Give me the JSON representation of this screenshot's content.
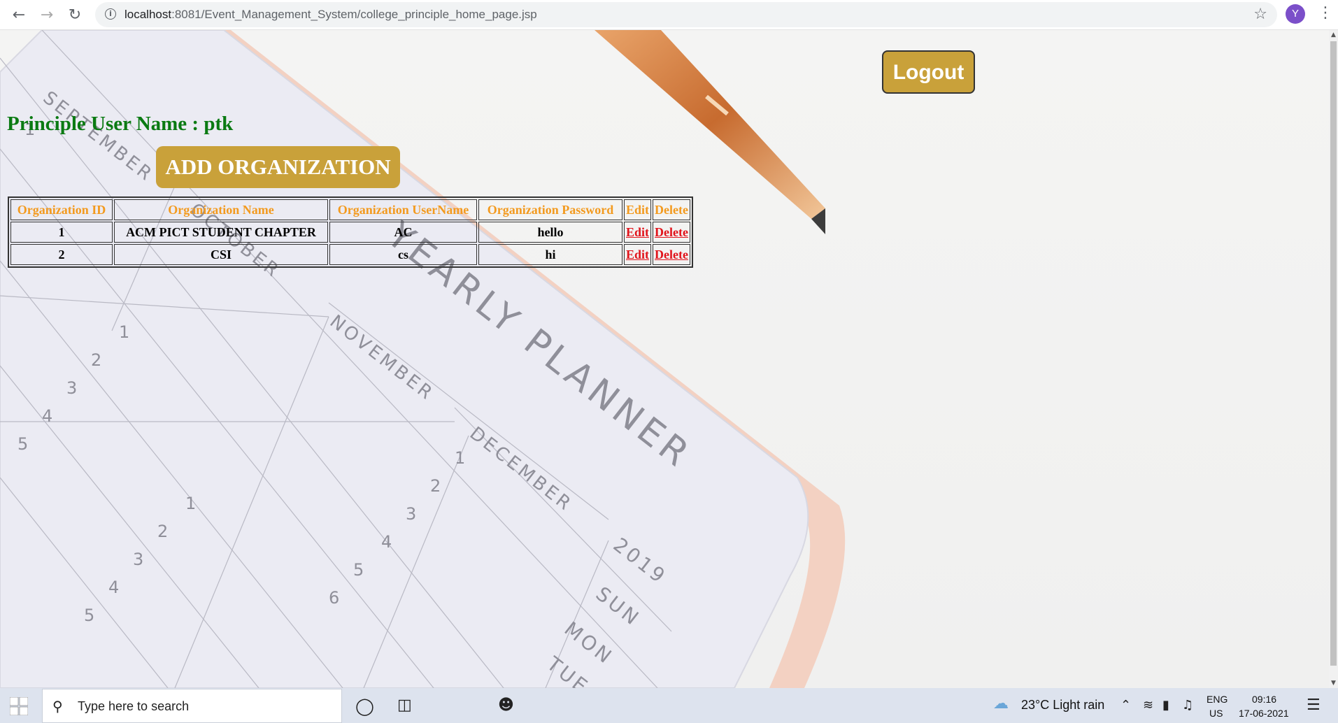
{
  "browser": {
    "url_host": "localhost",
    "url_path": ":8081/Event_Management_System/college_principle_home_page.jsp",
    "profile_initial": "Y"
  },
  "page": {
    "logout_label": "Logout",
    "principle_label": "Principle User Name : ptk",
    "add_org_label": "ADD ORGANIZATION",
    "table": {
      "headers": [
        "Organization ID",
        "Organization Name",
        "Organization UserName",
        "Organization Password",
        "Edit",
        "Delete"
      ],
      "rows": [
        {
          "id": "1",
          "name": "ACM PICT STUDENT CHAPTER",
          "username": "AC",
          "password": "hello",
          "edit": "Edit",
          "delete": "Delete"
        },
        {
          "id": "2",
          "name": "CSI",
          "username": "cs",
          "password": "hi",
          "edit": "Edit",
          "delete": "Delete"
        }
      ]
    }
  },
  "background": {
    "title": "YEARLY PLANNER",
    "months": [
      "SEPTEMBER",
      "OCTOBER",
      "NOVEMBER",
      "DECEMBER"
    ],
    "year": "2019",
    "days": [
      "SUN",
      "MON",
      "TUE"
    ]
  },
  "taskbar": {
    "search_placeholder": "Type here to search",
    "weather": "23°C  Light rain",
    "lang_top": "ENG",
    "lang_bottom": "US",
    "time": "09:16",
    "date": "17-06-2021"
  },
  "colors": {
    "button_gold": "#c9a13a",
    "principle_green": "#0a7a12",
    "header_orange": "#f39a1e",
    "link_red": "#e1141c"
  }
}
